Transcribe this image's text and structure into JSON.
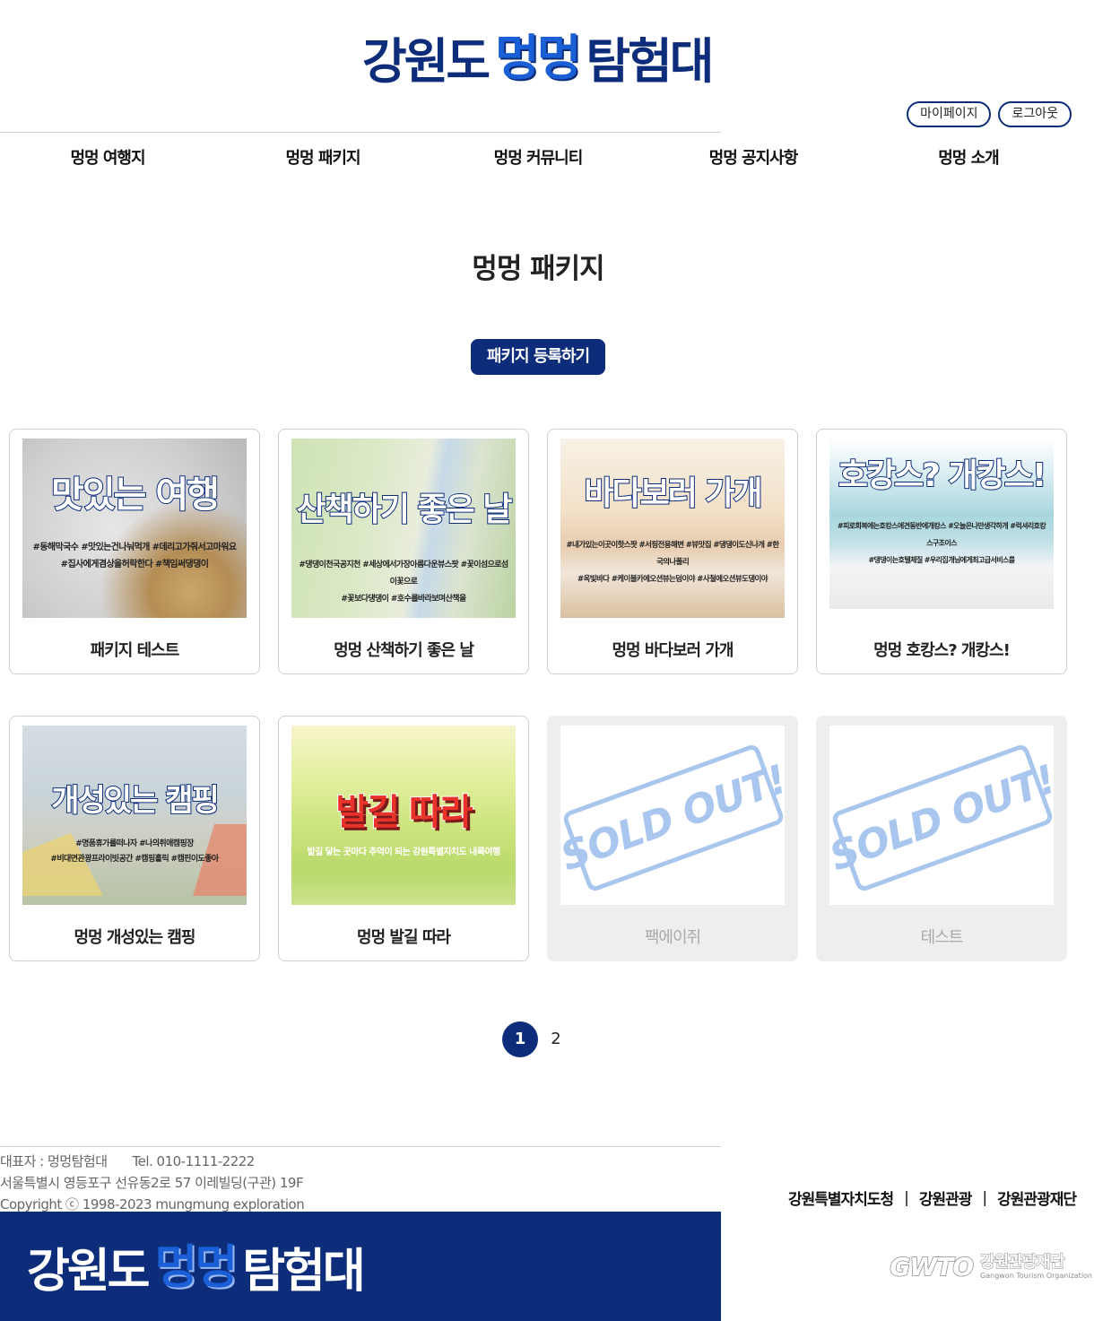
{
  "header": {
    "logo": {
      "part1": "강원도",
      "part2": "멍멍",
      "part3": "탐험대"
    },
    "auth": {
      "mypage": "마이페이지",
      "logout": "로그아웃"
    }
  },
  "nav": [
    {
      "label": "멍멍 여행지"
    },
    {
      "label": "멍멍 패키지"
    },
    {
      "label": "멍멍 커뮤니티"
    },
    {
      "label": "멍멍 공지사항"
    },
    {
      "label": "멍멍 소개"
    }
  ],
  "page": {
    "title": "멍멍 패키지",
    "register_button": "패키지 등록하기"
  },
  "packages": [
    {
      "title": "패키지 테스트",
      "headline": "맛있는 여행",
      "tags1": "#동해막국수 #맛있는건나눠먹개 #데리고가줘서고마워요",
      "tags2": "#집사에게겸상을허락한다 #책임써댕댕이",
      "sold_out": false
    },
    {
      "title": "멍멍 산책하기 좋은 날",
      "headline": "산책하기 좋은 날",
      "tags1": "#댕댕이천국공지천 #세상에서가장아름다운뷰스팟 #꽃이섬으로섬이꽃으로",
      "tags2": "#꽃보다댕댕이 #호수를바라보며산책을",
      "sold_out": false
    },
    {
      "title": "멍멍 바다보러 가개",
      "headline": "바다보러 가개",
      "tags1": "#내가있는이곳이핫스팟 #서핑전용해변 #뷰맛집 #댕댕이도신나개 #한국의나폴리",
      "tags2": "#옥빛바다 #케이블카에오션뷰는덤이야 #사철에오션뷰도댕이야",
      "sold_out": false
    },
    {
      "title": "멍멍 호캉스? 개캉스!",
      "headline": "호캉스? 개캉스!",
      "tags1": "#피로회복에는호캉스에견동반에개캉스 #오늘은나만생각하개 #럭셔리호캉스구조이스",
      "tags2": "#댕댕이는호텔체질 #우리집개님에게최고급서비스를",
      "sold_out": false
    },
    {
      "title": "멍멍 개성있는 캠핑",
      "headline": "개성있는 캠핑",
      "tags1": "#명품휴가를떠나자 #나의취애캠핑장",
      "tags2": "#비대면관광프라이빗공간 #캠핑홀릭 #캠핀이도좋아",
      "sold_out": false
    },
    {
      "title": "멍멍 발길 따라",
      "headline": "발길 따라",
      "tags1": "발길 닿는 곳마다 추억이 되는 강원특별자치도 내륙여행",
      "tags2": "",
      "sold_out": false
    },
    {
      "title": "팩에이쥐",
      "stamp": "SOLD OUT!",
      "sold_out": true
    },
    {
      "title": "테스트",
      "stamp": "SOLD OUT!",
      "sold_out": true
    }
  ],
  "pagination": {
    "pages": [
      "1",
      "2"
    ],
    "current": "1"
  },
  "footer": {
    "ceo": "대표자 : 멍멍탐험대",
    "tel": "Tel. 010-1111-2222",
    "address": "서울특별시 영등포구 선유동2로 57 이레빌딩(구관) 19F",
    "copyright": "Copyright ⓒ 1998-2023 mungmung exploration",
    "links": [
      "강원특별자치도청",
      "강원관광",
      "강원관광재단"
    ],
    "separator": "|",
    "logo": {
      "part1": "강원도",
      "part2": "멍멍",
      "part3": "탐험대"
    },
    "gwto": {
      "mark": "GWTO",
      "korean": "강원관광재단",
      "english": "Gangwon Tourism Organization"
    }
  },
  "colors": {
    "primary": "#0d2d7a",
    "accent": "#1a5fd6",
    "stamp": "#a9c6ef",
    "sold_bg": "#eeeeee"
  }
}
